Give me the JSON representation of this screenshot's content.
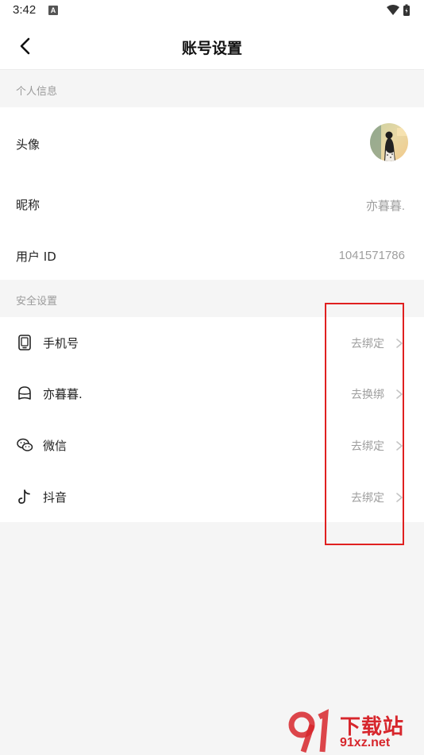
{
  "status_bar": {
    "time": "3:42",
    "notification_badge": "A"
  },
  "nav": {
    "title": "账号设置"
  },
  "personal_section": {
    "header": "个人信息",
    "avatar_label": "头像",
    "nickname_label": "昵称",
    "nickname_value": "亦暮暮.",
    "user_id_label": "用户 ID",
    "user_id_value": "1041571786"
  },
  "security_section": {
    "header": "安全设置",
    "items": [
      {
        "label": "手机号",
        "action": "去绑定",
        "icon": "phone-icon"
      },
      {
        "label": "亦暮暮.",
        "action": "去换绑",
        "icon": "user-icon"
      },
      {
        "label": "微信",
        "action": "去绑定",
        "icon": "wechat-icon"
      },
      {
        "label": "抖音",
        "action": "去绑定",
        "icon": "douyin-icon"
      }
    ]
  },
  "watermark": {
    "title": "下载站",
    "url": "91xz.net"
  },
  "colors": {
    "highlight": "#e02020",
    "watermark": "#d7262c",
    "secondary_text": "#9e9e9e"
  }
}
